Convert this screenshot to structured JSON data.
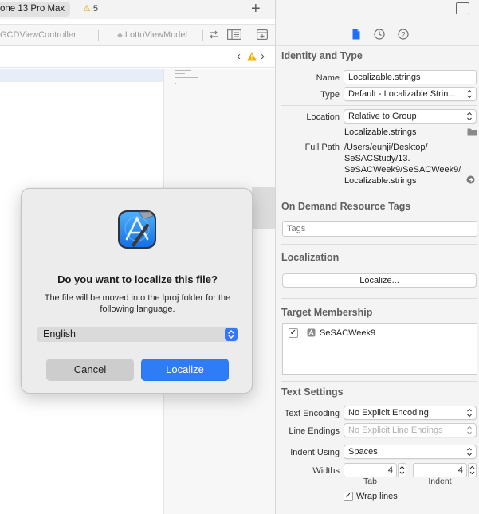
{
  "toolbar": {
    "scheme_device": "one 13 Pro Max",
    "warning_count": "5"
  },
  "tabs": [
    {
      "label": "GCDViewController"
    },
    {
      "label": "LottoViewModel"
    }
  ],
  "inspector": {
    "identity": {
      "title": "Identity and Type",
      "name_label": "Name",
      "name_value": "Localizable.strings",
      "type_label": "Type",
      "type_value": "Default - Localizable Strin...",
      "location_label": "Location",
      "location_value": "Relative to Group",
      "location_file": "Localizable.strings",
      "fullpath_label": "Full Path",
      "fullpath_lines": [
        "/Users/eunji/Desktop/",
        "SeSACStudy/13.",
        "SeSACWeek9/SeSACWeek9/",
        "Localizable.strings"
      ]
    },
    "tags": {
      "title": "On Demand Resource Tags",
      "placeholder": "Tags"
    },
    "localization": {
      "title": "Localization",
      "button": "Localize..."
    },
    "target": {
      "title": "Target Membership",
      "item": "SeSACWeek9",
      "checked": true
    },
    "text_settings": {
      "title": "Text Settings",
      "encoding_label": "Text Encoding",
      "encoding_value": "No Explicit Encoding",
      "line_endings_label": "Line Endings",
      "line_endings_value": "No Explicit Line Endings",
      "indent_label": "Indent Using",
      "indent_value": "Spaces",
      "widths_label": "Widths",
      "tab_value": "4",
      "indent_width_value": "4",
      "tab_caption": "Tab",
      "indent_caption": "Indent",
      "wrap_label": "Wrap lines",
      "wrap_checked": true
    }
  },
  "dialog": {
    "title": "Do you want to localize this file?",
    "message": "The file will be moved into the lproj folder for the following language.",
    "language": "English",
    "cancel": "Cancel",
    "confirm": "Localize"
  },
  "colors": {
    "accent": "#2f7df6",
    "warning": "#e9a100"
  }
}
